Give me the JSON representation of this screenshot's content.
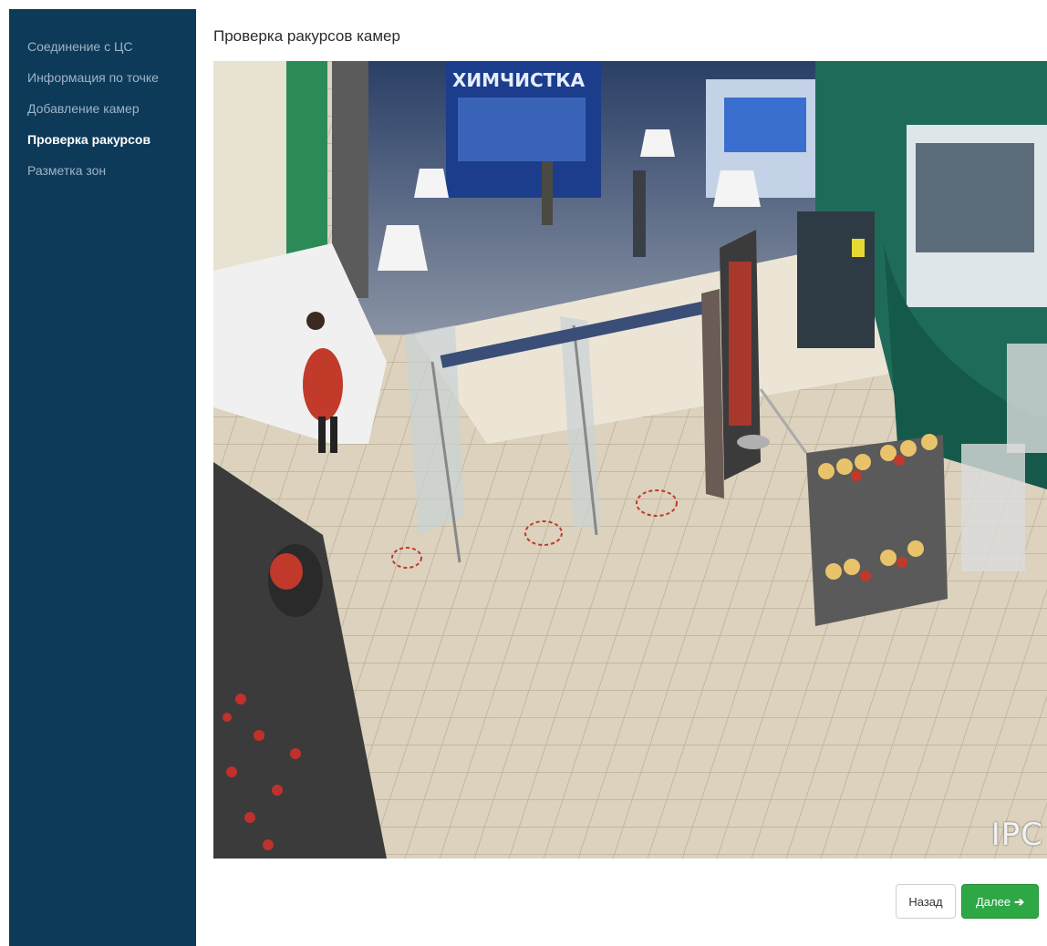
{
  "sidebar": {
    "items": [
      {
        "label": "Соединение с ЦС",
        "active": false
      },
      {
        "label": "Информация по точке",
        "active": false
      },
      {
        "label": "Добавление камер",
        "active": false
      },
      {
        "label": "Проверка ракурсов",
        "active": true
      },
      {
        "label": "Разметка зон",
        "active": false
      }
    ]
  },
  "main": {
    "title": "Проверка ракурсов камер",
    "camera": {
      "overlay_text": "IPC",
      "store_sign": "ХИМЧИСТКА"
    }
  },
  "footer": {
    "back_label": "Назад",
    "next_label": "Далее",
    "next_icon": "arrow-right-icon"
  },
  "colors": {
    "sidebar_bg": "#0e3a5a",
    "sidebar_text": "#9fb4c6",
    "sidebar_active": "#ffffff",
    "next_button": "#2ea745"
  }
}
